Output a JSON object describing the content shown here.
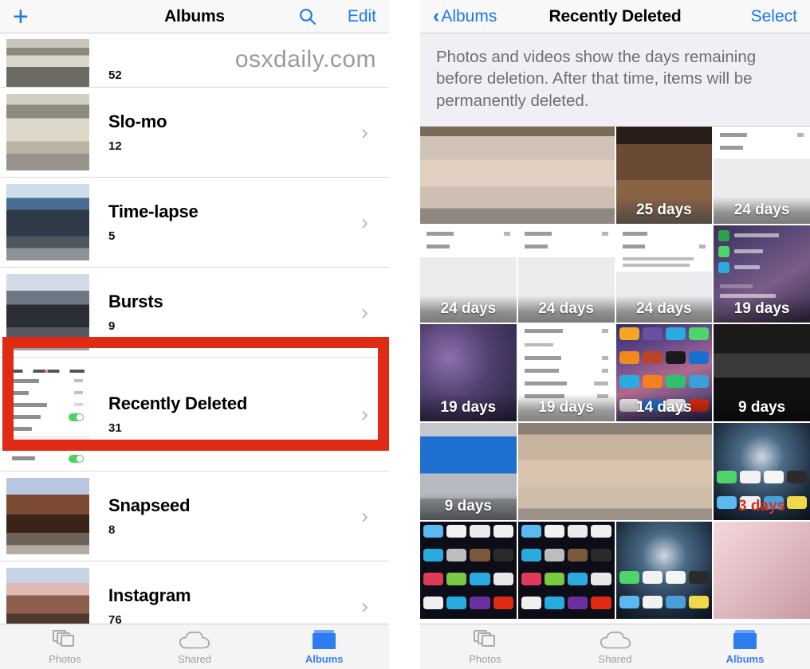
{
  "left_panel": {
    "navbar": {
      "add_label": "+",
      "title": "Albums",
      "search_icon": "search-icon",
      "edit_label": "Edit"
    },
    "watermark": "osxdaily.com",
    "albums": [
      {
        "title": "",
        "count": "52",
        "partial": true
      },
      {
        "title": "Slo-mo",
        "count": "12"
      },
      {
        "title": "Time-lapse",
        "count": "5"
      },
      {
        "title": "Bursts",
        "count": "9"
      },
      {
        "title": "Recently Deleted",
        "count": "31",
        "highlighted": true
      },
      {
        "title": "Snapseed",
        "count": "8"
      },
      {
        "title": "Instagram",
        "count": "76"
      }
    ],
    "tabbar": [
      {
        "label": "Photos",
        "icon": "photos-icon",
        "active": false
      },
      {
        "label": "Shared",
        "icon": "cloud-icon",
        "active": false
      },
      {
        "label": "Albums",
        "icon": "albums-icon",
        "active": true
      }
    ]
  },
  "right_panel": {
    "navbar": {
      "back_label": "Albums",
      "back_icon": "chevron-left-icon",
      "title": "Recently Deleted",
      "select_label": "Select"
    },
    "notice": "Photos and videos show the days remaining before deletion. After that time, items will be permanently deleted.",
    "grid": [
      {
        "badge": "",
        "art": "a-blur1",
        "wide": true
      },
      {
        "badge": "25 days",
        "art": "a-table"
      },
      {
        "badge": "24 days",
        "art": "a-settings"
      },
      {
        "badge": "24 days",
        "art": "a-settings"
      },
      {
        "badge": "24 days",
        "art": "a-settings"
      },
      {
        "badge": "24 days",
        "art": "a-settings"
      },
      {
        "badge": "19 days",
        "art": "a-lockscr"
      },
      {
        "badge": "19 days",
        "art": "a-blurpurple"
      },
      {
        "badge": "19 days",
        "art": "a-settings"
      },
      {
        "badge": "14 days",
        "art": "a-homescreen"
      },
      {
        "badge": "9 days",
        "art": "a-dark"
      },
      {
        "badge": "9 days",
        "art": "a-blueui"
      },
      {
        "badge": "",
        "art": "a-skin",
        "wide": true
      },
      {
        "badge": "3 days",
        "art": "a-galaxy",
        "badge_red": true
      },
      {
        "badge": "",
        "art": "a-icons"
      },
      {
        "badge": "",
        "art": "a-icons"
      },
      {
        "badge": "",
        "art": "a-galaxy"
      },
      {
        "badge": "",
        "art": "a-keyboard"
      }
    ],
    "tabbar": [
      {
        "label": "Photos",
        "icon": "photos-icon",
        "active": false
      },
      {
        "label": "Shared",
        "icon": "cloud-icon",
        "active": false
      },
      {
        "label": "Albums",
        "icon": "albums-icon",
        "active": true
      }
    ]
  },
  "colors": {
    "accent_blue": "#1878f0",
    "highlight_red": "#e02b14",
    "notice_bg": "#efeff4",
    "navbar_bg": "#f8f8f8"
  }
}
